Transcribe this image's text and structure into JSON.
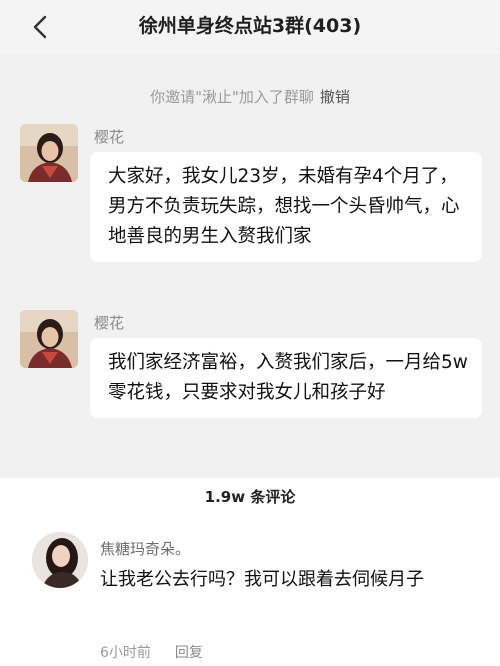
{
  "header": {
    "title": "徐州单身终点站3群(403)"
  },
  "system_notice": {
    "text": "你邀请\"湫止\"加入了群聊",
    "undo_label": "撤销"
  },
  "messages": [
    {
      "sender": "樱花",
      "text": "大家好，我女儿23岁，未婚有孕4个月了，男方不负责玩失踪，想找一个头昏帅气，心地善良的男生入赘我们家"
    },
    {
      "sender": "樱花",
      "text": "我们家经济富裕，入赘我们家后，一月给5w零花钱，只要求对我女儿和孩子好"
    }
  ],
  "comments_section": {
    "count_label": "1.9w 条评论",
    "comments": [
      {
        "user": "焦糖玛奇朵。",
        "text": "让我老公去行吗？我可以跟着去伺候月子",
        "time": "6小时前",
        "reply_label": "回复"
      }
    ]
  },
  "colors": {
    "chat_background": "#f1f1f1",
    "bubble": "#ffffff",
    "muted_text": "#9a9a9a"
  },
  "icons": {
    "back": "chevron-left-icon"
  }
}
